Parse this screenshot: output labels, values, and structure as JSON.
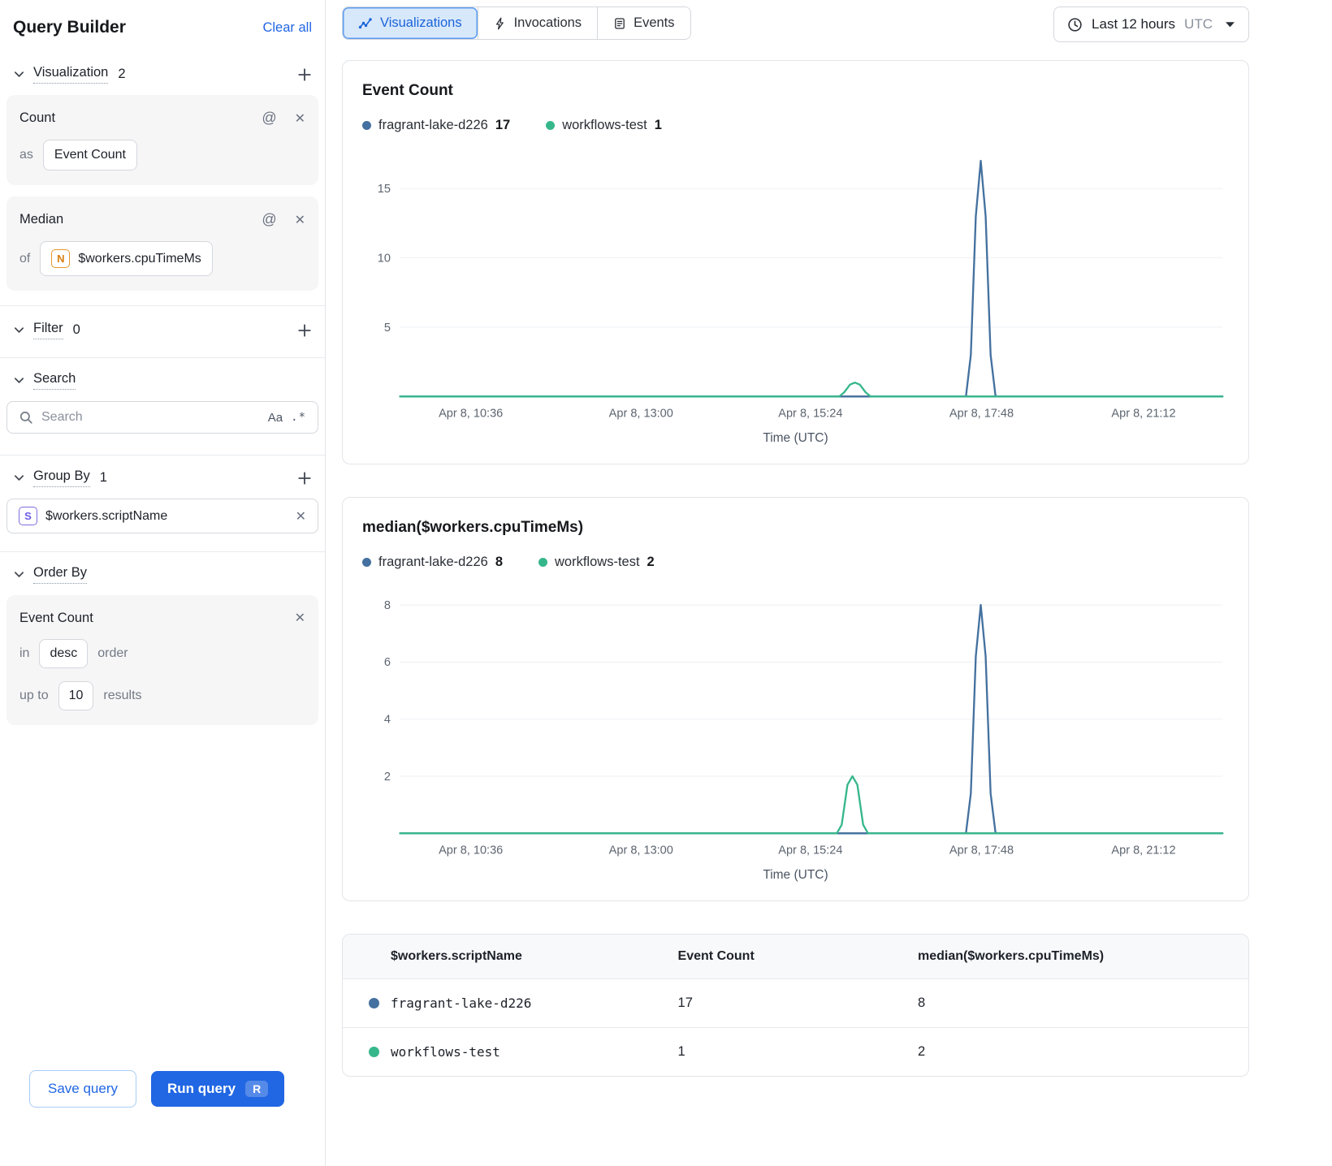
{
  "colors": {
    "accent_blue": "#2166e3",
    "series_blue": "#44719f",
    "series_green": "#36b78b"
  },
  "sidebar": {
    "title": "Query Builder",
    "clear_all_label": "Clear all",
    "visualization": {
      "label": "Visualization",
      "count": "2",
      "cards": [
        {
          "title": "Count",
          "prefix": "as",
          "value": "Event Count"
        },
        {
          "title": "Median",
          "prefix": "of",
          "type_badge": "N",
          "value": "$workers.cpuTimeMs"
        }
      ]
    },
    "filter": {
      "label": "Filter",
      "count": "0"
    },
    "search": {
      "label": "Search",
      "placeholder": "Search",
      "match_case_icon": "Aa",
      "regex_icon": ".*"
    },
    "group_by": {
      "label": "Group By",
      "count": "1",
      "items": [
        {
          "type_badge": "S",
          "value": "$workers.scriptName"
        }
      ]
    },
    "order_by": {
      "label": "Order By",
      "field": "Event Count",
      "in_label": "in",
      "direction": "desc",
      "order_label": "order",
      "up_to_label": "up to",
      "limit": "10",
      "results_label": "results"
    },
    "save_button": "Save query",
    "run_button": "Run query",
    "run_shortcut": "R"
  },
  "header": {
    "tabs": [
      {
        "label": "Visualizations"
      },
      {
        "label": "Invocations"
      },
      {
        "label": "Events"
      }
    ],
    "time_range": "Last 12 hours",
    "timezone": "UTC"
  },
  "chart_data": [
    {
      "type": "line",
      "title": "Event Count",
      "xlabel": "Time (UTC)",
      "ylim": [
        0,
        17.5
      ],
      "yticks": [
        5,
        10,
        15
      ],
      "xticks": [
        {
          "label": "Apr 8, 10:36",
          "f": 0.086
        },
        {
          "label": "Apr 8, 13:00",
          "f": 0.293
        },
        {
          "label": "Apr 8, 15:24",
          "f": 0.499
        },
        {
          "label": "Apr 8, 17:48",
          "f": 0.707
        },
        {
          "label": "Apr 8, 21:12",
          "f": 0.904
        }
      ],
      "series": [
        {
          "name": "fragrant-lake-d226",
          "color": "#44719f",
          "total": "17",
          "line": [
            [
              0,
              0
            ],
            [
              0.688,
              0
            ],
            [
              0.694,
              3
            ],
            [
              0.7,
              13
            ],
            [
              0.706,
              17
            ],
            [
              0.712,
              13
            ],
            [
              0.718,
              3
            ],
            [
              0.724,
              0
            ],
            [
              1,
              0
            ]
          ]
        },
        {
          "name": "workflows-test",
          "color": "#36b78b",
          "total": "1",
          "line": [
            [
              0,
              0
            ],
            [
              0.534,
              0
            ],
            [
              0.54,
              0.3
            ],
            [
              0.547,
              0.85
            ],
            [
              0.553,
              1
            ],
            [
              0.559,
              0.85
            ],
            [
              0.566,
              0.3
            ],
            [
              0.572,
              0
            ],
            [
              1,
              0
            ]
          ]
        }
      ]
    },
    {
      "type": "line",
      "title": "median($workers.cpuTimeMs)",
      "xlabel": "Time (UTC)",
      "ylim": [
        0,
        8.5
      ],
      "yticks": [
        2,
        4,
        6,
        8
      ],
      "xticks": [
        {
          "label": "Apr 8, 10:36",
          "f": 0.086
        },
        {
          "label": "Apr 8, 13:00",
          "f": 0.293
        },
        {
          "label": "Apr 8, 15:24",
          "f": 0.499
        },
        {
          "label": "Apr 8, 17:48",
          "f": 0.707
        },
        {
          "label": "Apr 8, 21:12",
          "f": 0.904
        }
      ],
      "series": [
        {
          "name": "fragrant-lake-d226",
          "color": "#44719f",
          "total": "8",
          "line": [
            [
              0,
              0
            ],
            [
              0.688,
              0
            ],
            [
              0.694,
              1.4
            ],
            [
              0.7,
              6.2
            ],
            [
              0.706,
              8
            ],
            [
              0.712,
              6.2
            ],
            [
              0.718,
              1.4
            ],
            [
              0.724,
              0
            ],
            [
              1,
              0
            ]
          ]
        },
        {
          "name": "workflows-test",
          "color": "#36b78b",
          "total": "2",
          "line": [
            [
              0,
              0
            ],
            [
              0.531,
              0
            ],
            [
              0.537,
              0.3
            ],
            [
              0.544,
              1.7
            ],
            [
              0.55,
              2
            ],
            [
              0.556,
              1.7
            ],
            [
              0.563,
              0.3
            ],
            [
              0.569,
              0
            ],
            [
              1,
              0
            ]
          ]
        }
      ]
    }
  ],
  "table": {
    "headers": [
      "$workers.scriptName",
      "Event Count",
      "median($workers.cpuTimeMs)"
    ],
    "rows": [
      {
        "name": "fragrant-lake-d226",
        "event_count": "17",
        "median": "8"
      },
      {
        "name": "workflows-test",
        "event_count": "1",
        "median": "2"
      }
    ]
  }
}
